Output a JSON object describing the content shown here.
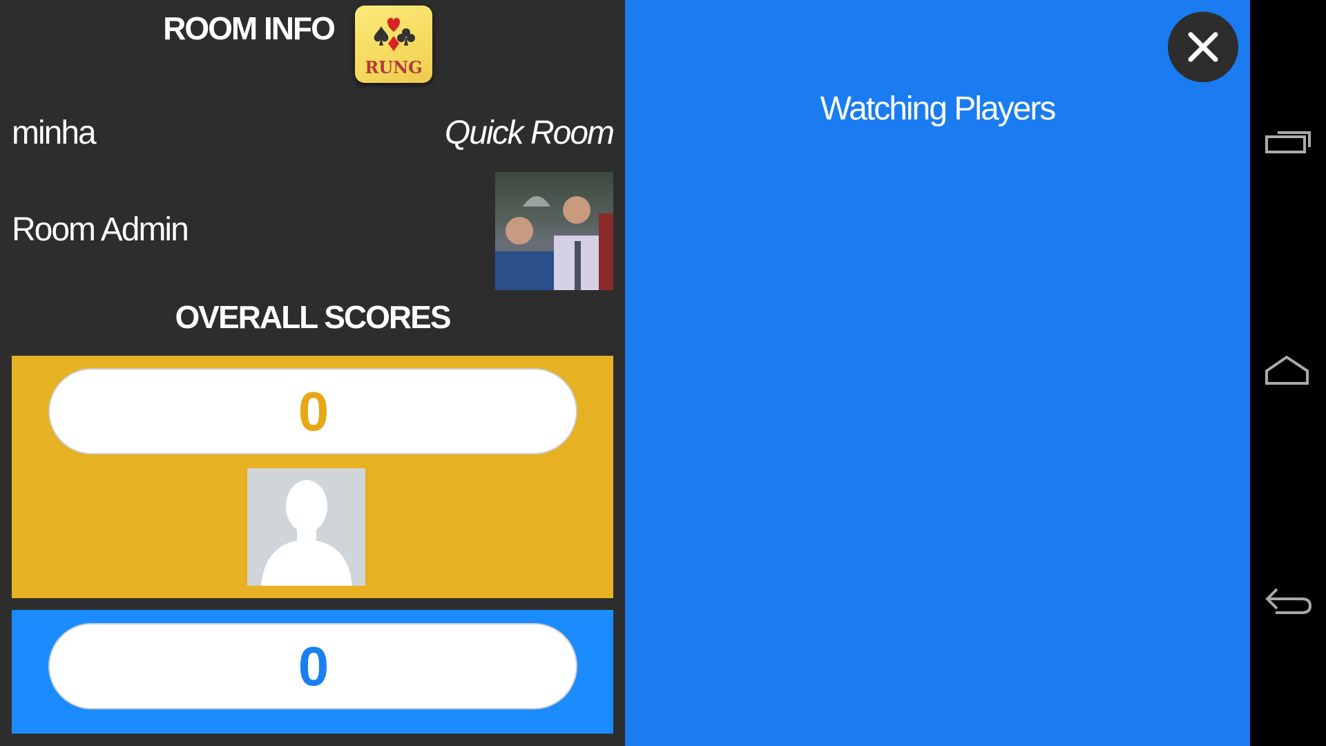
{
  "room_info": {
    "title": "ROOM INFO",
    "logo_text": "RUNG",
    "player_name": "minha",
    "room_type": "Quick Room",
    "role": "Room Admin"
  },
  "scores": {
    "title": "OVERALL SCORES",
    "teams": [
      {
        "score": "0",
        "color": "#e6b122"
      },
      {
        "score": "0",
        "color": "#1a8cff"
      }
    ]
  },
  "watching": {
    "title": "Watching Players",
    "background": "#1a7cf0"
  },
  "icons": {
    "close": "close-icon",
    "recent_apps": "recent-apps-icon",
    "home": "home-icon",
    "back": "back-icon"
  }
}
